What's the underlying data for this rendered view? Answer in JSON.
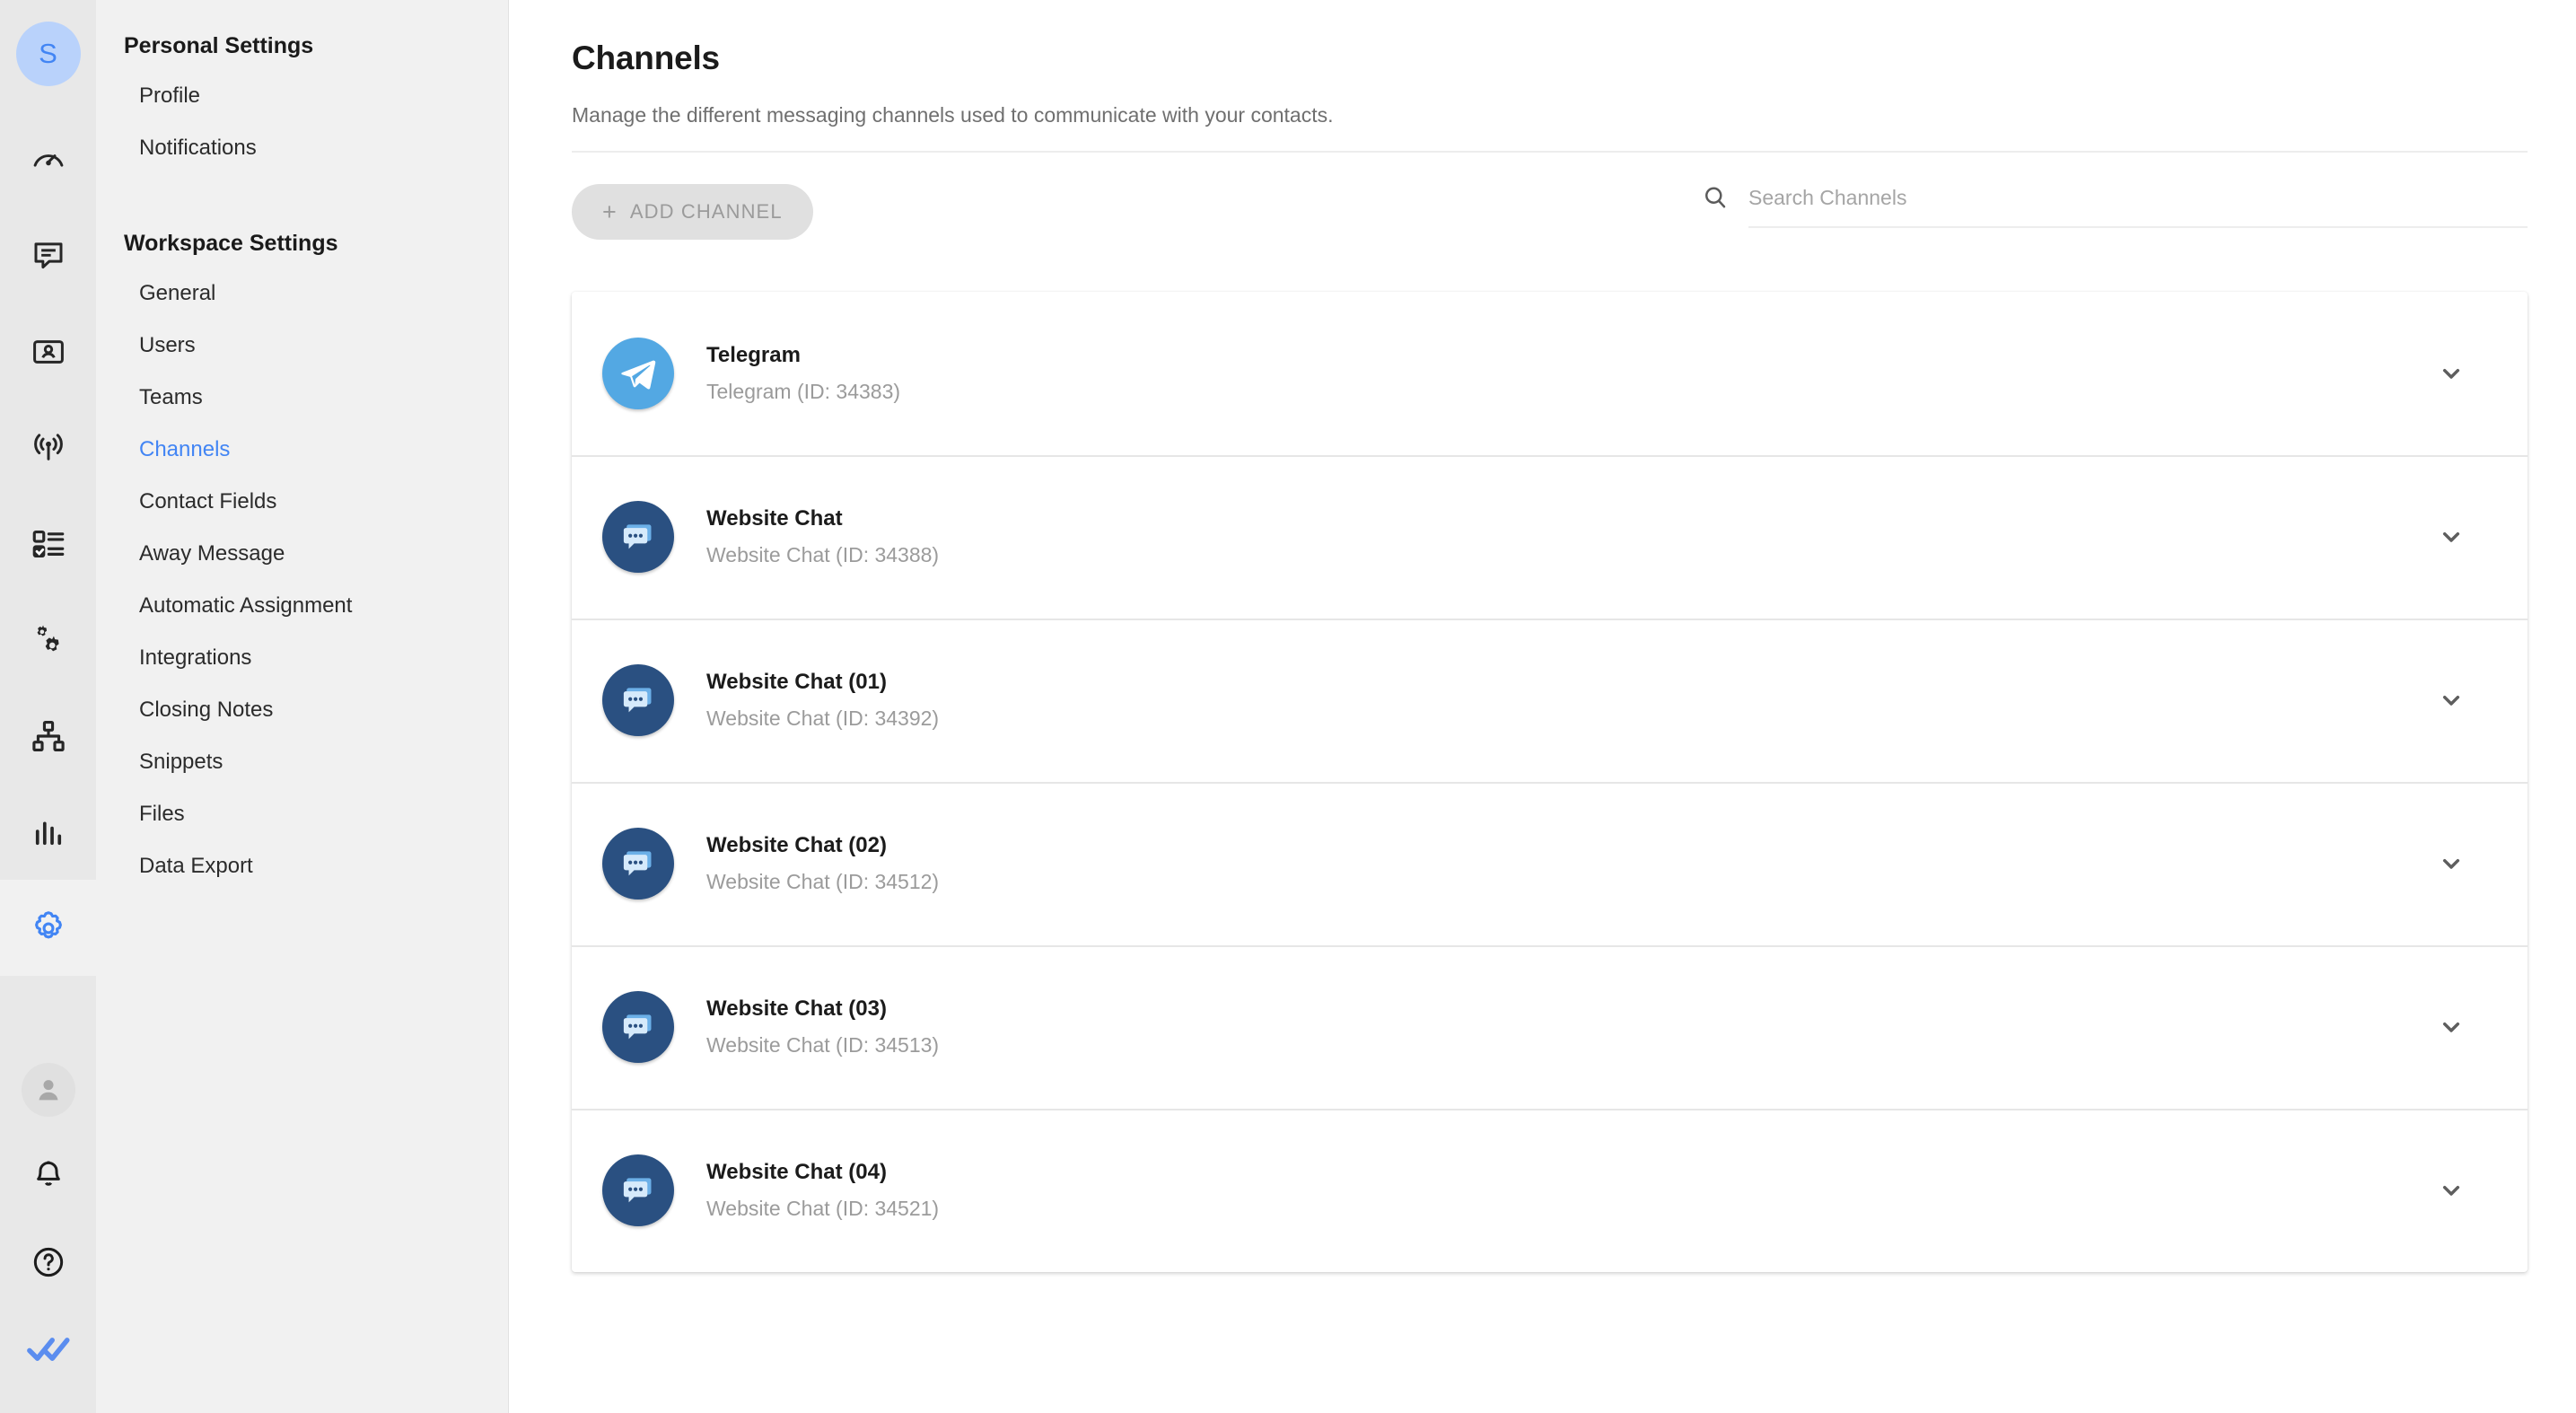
{
  "rail": {
    "workspace_avatar_label": "S",
    "icons": [
      {
        "name": "dashboard-gauge-icon"
      },
      {
        "name": "messages-chat-icon"
      },
      {
        "name": "contacts-card-icon"
      },
      {
        "name": "broadcast-antenna-icon"
      },
      {
        "name": "checklist-icon"
      },
      {
        "name": "automations-gears-icon"
      },
      {
        "name": "workflows-hierarchy-icon"
      },
      {
        "name": "reports-bar-chart-icon"
      },
      {
        "name": "settings-gear-icon"
      }
    ],
    "bottom_icons": [
      {
        "name": "user-avatar-icon"
      },
      {
        "name": "notifications-bell-icon"
      },
      {
        "name": "help-question-icon"
      },
      {
        "name": "double-check-logo-icon"
      }
    ]
  },
  "sidebar": {
    "personal_heading": "Personal Settings",
    "personal_items": [
      {
        "label": "Profile"
      },
      {
        "label": "Notifications"
      }
    ],
    "workspace_heading": "Workspace Settings",
    "workspace_items": [
      {
        "label": "General"
      },
      {
        "label": "Users"
      },
      {
        "label": "Teams"
      },
      {
        "label": "Channels"
      },
      {
        "label": "Contact Fields"
      },
      {
        "label": "Away Message"
      },
      {
        "label": "Automatic Assignment"
      },
      {
        "label": "Integrations"
      },
      {
        "label": "Closing Notes"
      },
      {
        "label": "Snippets"
      },
      {
        "label": "Files"
      },
      {
        "label": "Data Export"
      }
    ],
    "active_item": "Channels"
  },
  "main": {
    "title": "Channels",
    "subtitle": "Manage the different messaging channels used to communicate with your contacts.",
    "add_channel_label": "ADD CHANNEL",
    "add_channel_plus": "+",
    "search_placeholder": "Search Channels",
    "search_value": "",
    "channels": [
      {
        "name": "Telegram",
        "meta": "Telegram (ID: 34383)",
        "type": "telegram"
      },
      {
        "name": "Website Chat",
        "meta": "Website Chat (ID: 34388)",
        "type": "webchat"
      },
      {
        "name": "Website Chat (01)",
        "meta": "Website Chat (ID: 34392)",
        "type": "webchat"
      },
      {
        "name": "Website Chat (02)",
        "meta": "Website Chat (ID: 34512)",
        "type": "webchat"
      },
      {
        "name": "Website Chat (03)",
        "meta": "Website Chat (ID: 34513)",
        "type": "webchat"
      },
      {
        "name": "Website Chat (04)",
        "meta": "Website Chat (ID: 34521)",
        "type": "webchat"
      }
    ]
  },
  "colors": {
    "accent_blue": "#4285f4",
    "telegram_blue": "#53a8e3",
    "webchat_navy": "#2a5081",
    "rail_bg": "#e8e8e8",
    "sidebar_bg": "#f1f1f1"
  }
}
